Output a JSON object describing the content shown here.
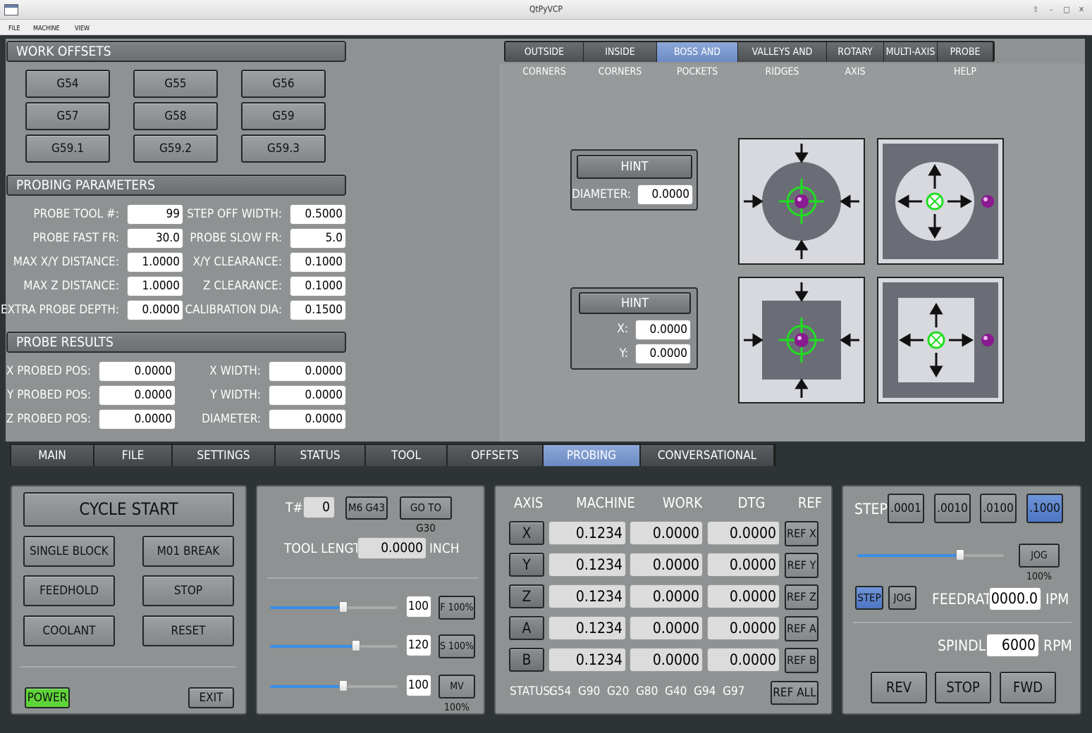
{
  "window": {
    "title": "QtPyVCP"
  },
  "menu": [
    "FILE",
    "MACHINE",
    "VIEW"
  ],
  "work_offsets": {
    "title": "WORK OFFSETS",
    "buttons": [
      "G54",
      "G55",
      "G56",
      "G57",
      "G58",
      "G59",
      "G59.1",
      "G59.2",
      "G59.3"
    ]
  },
  "probing_params": {
    "title": "PROBING PARAMETERS",
    "left": [
      {
        "label": "PROBE TOOL #:",
        "value": "99"
      },
      {
        "label": "PROBE FAST FR:",
        "value": "30.0"
      },
      {
        "label": "MAX X/Y DISTANCE:",
        "value": "1.0000"
      },
      {
        "label": "MAX Z DISTANCE:",
        "value": "1.0000"
      },
      {
        "label": "EXTRA PROBE DEPTH:",
        "value": "0.0000"
      }
    ],
    "right": [
      {
        "label": "STEP OFF WIDTH:",
        "value": "0.5000"
      },
      {
        "label": "PROBE SLOW FR:",
        "value": "5.0"
      },
      {
        "label": "X/Y CLEARANCE:",
        "value": "0.1000"
      },
      {
        "label": "Z CLEARANCE:",
        "value": "0.1000"
      },
      {
        "label": "CALIBRATION DIA:",
        "value": "0.1500"
      }
    ]
  },
  "probe_results": {
    "title": "PROBE RESULTS",
    "left": [
      {
        "label": "X PROBED POS:",
        "value": "0.0000"
      },
      {
        "label": "Y PROBED POS:",
        "value": "0.0000"
      },
      {
        "label": "Z PROBED POS:",
        "value": "0.0000"
      }
    ],
    "right": [
      {
        "label": "X WIDTH:",
        "value": "0.0000"
      },
      {
        "label": "Y WIDTH:",
        "value": "0.0000"
      },
      {
        "label": "DIAMETER:",
        "value": "0.0000"
      }
    ]
  },
  "probe_tabs": [
    "OUTSIDE CORNERS",
    "INSIDE CORNERS",
    "BOSS AND POCKETS",
    "VALLEYS AND RIDGES",
    "ROTARY AXIS",
    "MULTI-AXIS",
    "PROBE HELP"
  ],
  "probe_tab_active": "BOSS AND POCKETS",
  "hint1": {
    "button": "HINT",
    "label": "DIAMETER:",
    "value": "0.0000"
  },
  "hint2": {
    "button": "HINT",
    "x_label": "X:",
    "x_value": "0.0000",
    "y_label": "Y:",
    "y_value": "0.0000"
  },
  "bottom_tabs": [
    "MAIN",
    "FILE",
    "SETTINGS",
    "STATUS",
    "TOOL",
    "OFFSETS",
    "PROBING",
    "CONVERSATIONAL"
  ],
  "bottom_tab_active": "PROBING",
  "controls": {
    "cycle_start": "CYCLE START",
    "single_block": "SINGLE BLOCK",
    "m01_break": "M01 BREAK",
    "feedhold": "FEEDHOLD",
    "stop": "STOP",
    "coolant": "COOLANT",
    "reset": "RESET",
    "power": "POWER",
    "exit": "EXIT"
  },
  "tool": {
    "t_label": "T#",
    "t_value": "0",
    "m6_button": "M6 G43",
    "g30_button": "GO TO G30",
    "length_label": "TOOL LENGTH",
    "length_value": "0.0000",
    "length_unit": "INCH",
    "overrides": [
      {
        "value": "100",
        "button": "F 100%",
        "level": 0.58
      },
      {
        "value": "120",
        "button": "S 100%",
        "level": 0.68
      },
      {
        "value": "100",
        "button": "MV 100%",
        "level": 0.58
      }
    ]
  },
  "dro": {
    "headers": [
      "AXIS",
      "MACHINE",
      "WORK",
      "DTG",
      "REF"
    ],
    "rows": [
      {
        "axis": "X",
        "machine": "0.1234",
        "work": "0.0000",
        "dtg": "0.0000",
        "ref": "REF X"
      },
      {
        "axis": "Y",
        "machine": "0.1234",
        "work": "0.0000",
        "dtg": "0.0000",
        "ref": "REF Y"
      },
      {
        "axis": "Z",
        "machine": "0.1234",
        "work": "0.0000",
        "dtg": "0.0000",
        "ref": "REF Z"
      },
      {
        "axis": "A",
        "machine": "0.1234",
        "work": "0.0000",
        "dtg": "0.0000",
        "ref": "REF A"
      },
      {
        "axis": "B",
        "machine": "0.1234",
        "work": "0.0000",
        "dtg": "0.0000",
        "ref": "REF B"
      }
    ],
    "status_label": "STATUS:",
    "status_codes": "G54  G90  G20  G80  G40  G94  G97",
    "ref_all": "REF ALL"
  },
  "jog": {
    "step_label": "STEP",
    "steps": [
      ".0001",
      ".0010",
      ".0100",
      ".1000"
    ],
    "active_step": ".1000",
    "jog_button": "JOG 100%",
    "jog_level": 0.7,
    "mode_step": "STEP",
    "mode_jog": "JOG",
    "feedrate_label": "FEEDRATE",
    "feedrate_value": "0000.0",
    "feedrate_unit": "IPM",
    "spindle_label": "SPINDLE",
    "spindle_value": "6000",
    "spindle_unit": "RPM",
    "rev": "REV",
    "stop": "STOP",
    "fwd": "FWD"
  },
  "colors": {
    "active_tab": "#7b97cc",
    "power_green": "#5fd33a",
    "probe_green": "#22dd22",
    "probe_ball": "#8a1a8f"
  }
}
